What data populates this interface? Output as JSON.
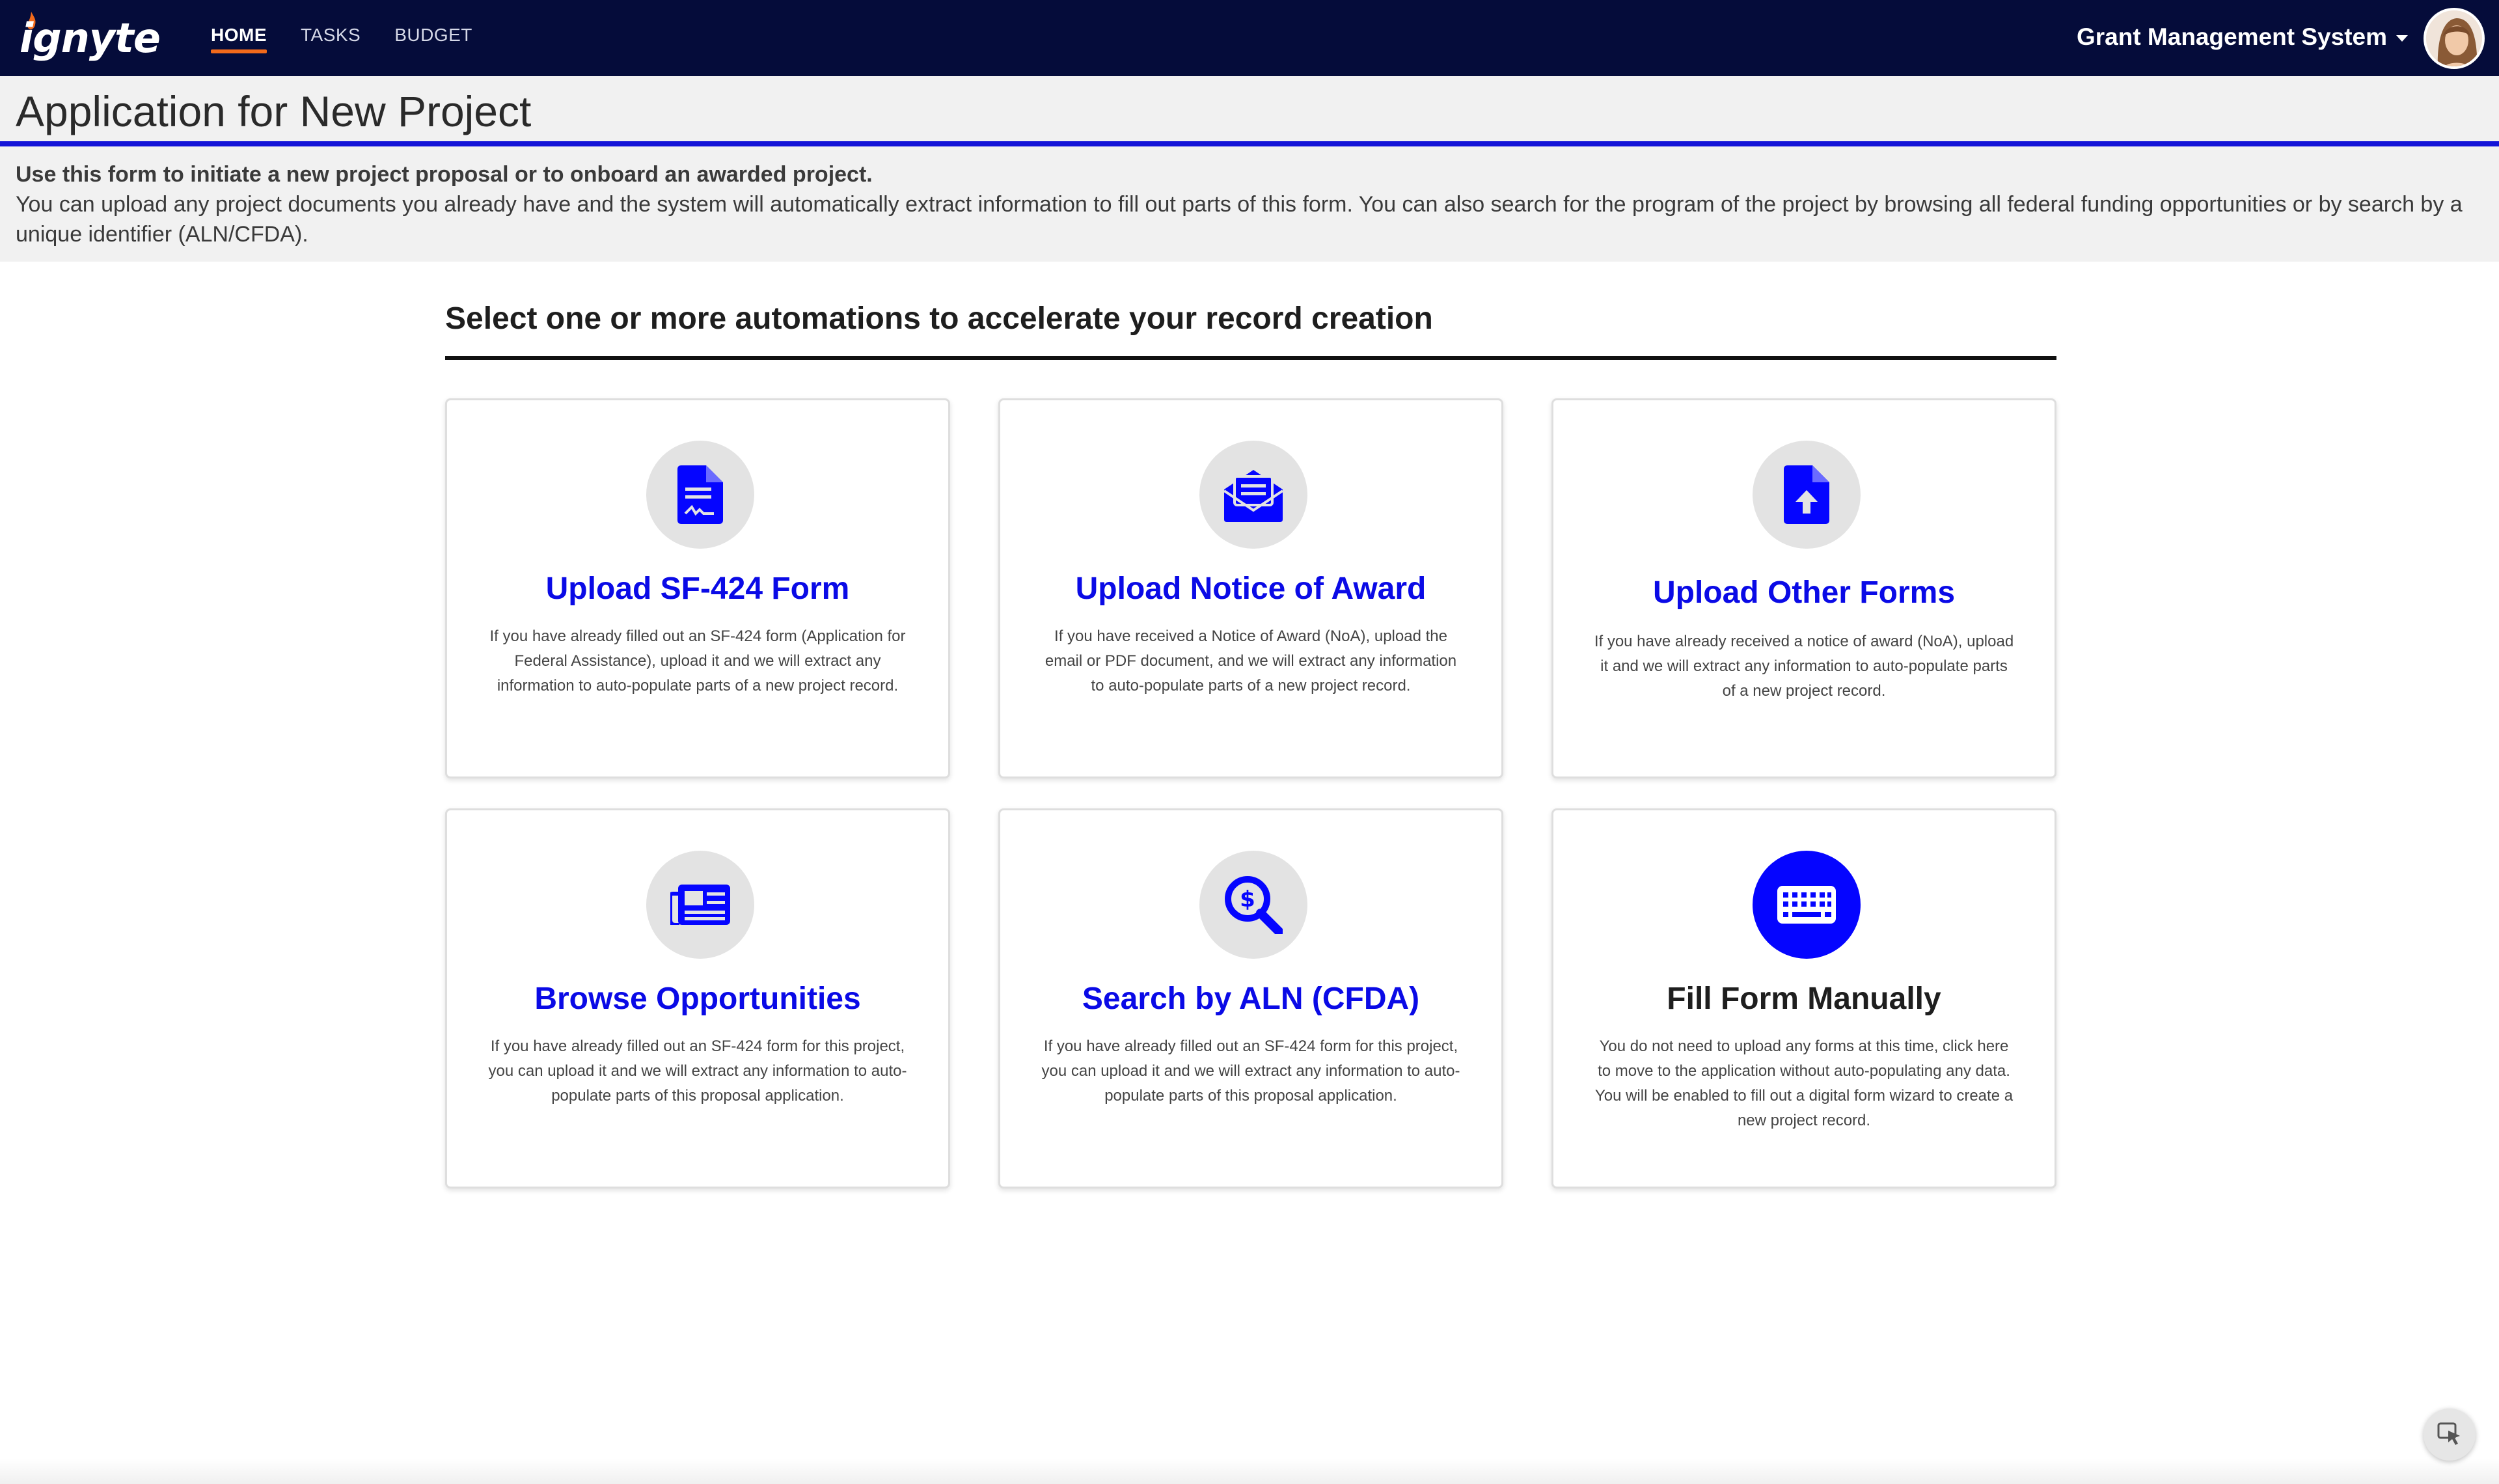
{
  "topbar": {
    "logo_text": "ignyte",
    "nav": [
      {
        "label": "HOME",
        "active": true
      },
      {
        "label": "TASKS",
        "active": false
      },
      {
        "label": "BUDGET",
        "active": false
      }
    ],
    "system_menu": "Grant Management System",
    "colors": {
      "background": "#050c3a",
      "active_underline": "#f26a1b"
    }
  },
  "page": {
    "title": "Application for New Project",
    "intro_bold": "Use this form to initiate a new project proposal or to onboard an awarded project.",
    "intro_text": "You can upload any project documents you already have and the system will automatically extract information to fill out parts of this form. You can also search for the program of the project by browsing all federal funding opportunities or by search by a unique identifier (ALN/CFDA)."
  },
  "automations": {
    "heading": "Select one or more automations to accelerate your record creation",
    "accent_color": "#0a0ae6",
    "cards": [
      {
        "icon": "signed-document-icon",
        "title": "Upload SF-424 Form",
        "description": "If you have already filled out an SF-424 form (Application for Federal Assistance), upload it and we will extract any information to auto-populate parts of a new project record."
      },
      {
        "icon": "envelope-letter-icon",
        "title": "Upload Notice of Award",
        "description": "If you have received a Notice of Award (NoA), upload the email or PDF document, and we will extract any information to auto-populate parts of a new project record."
      },
      {
        "icon": "file-upload-icon",
        "title": "Upload Other Forms",
        "description": "If you have already received a notice of award (NoA), upload it and we will extract any information to auto-populate parts of a new project record."
      },
      {
        "icon": "newspaper-icon",
        "title": "Browse Opportunities",
        "description": "If you have already filled out an SF-424 form for this project, you can upload it and we will extract any information to auto-populate parts of this proposal application."
      },
      {
        "icon": "dollar-search-icon",
        "title": "Search by ALN (CFDA)",
        "description": "If you have already filled out an SF-424 form for this project, you can upload it and we will extract any information to auto-populate parts of this proposal application."
      },
      {
        "icon": "keyboard-icon",
        "title": "Fill Form Manually",
        "description": "You do not need to upload any forms at this time, click here to move to the application without auto-populating any data. You will be enabled to fill out a digital form wizard to create a new project record."
      }
    ]
  }
}
